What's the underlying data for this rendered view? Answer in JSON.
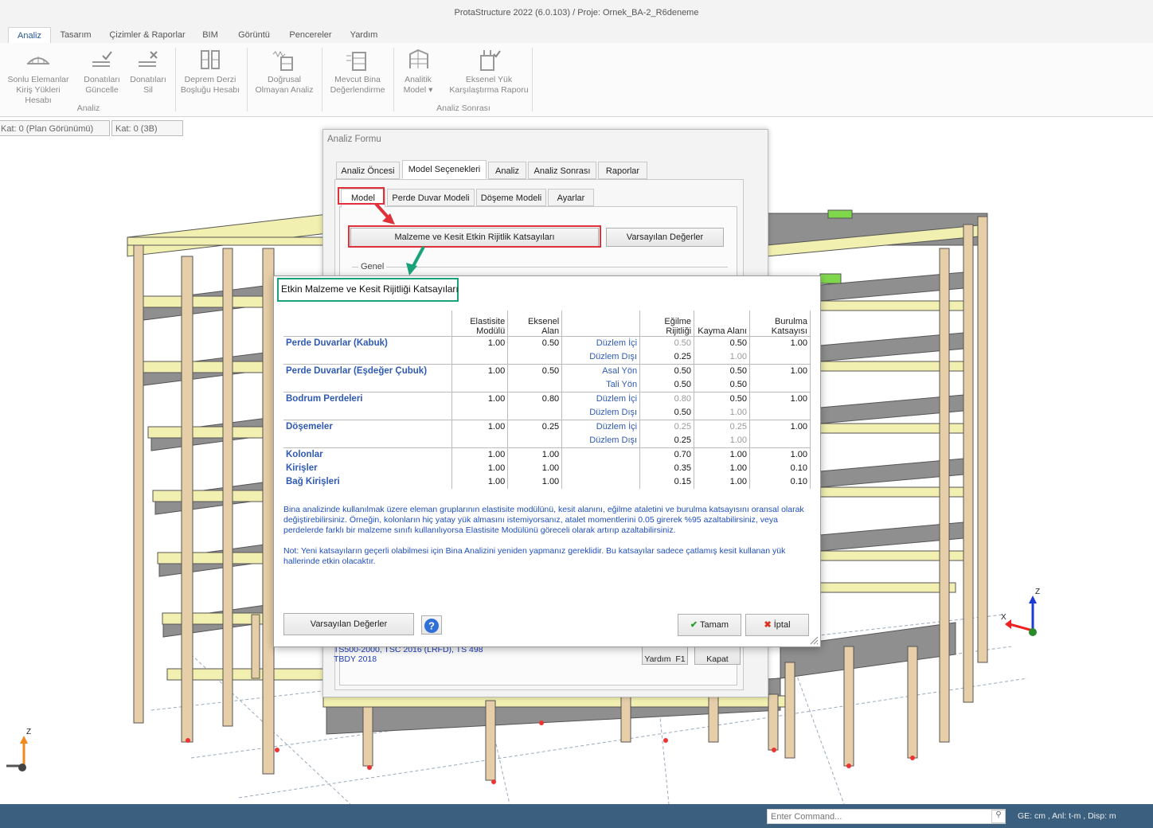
{
  "window": {
    "title": "ProtaStructure 2022 (6.0.103) / Proje: Ornek_BA-2_R6deneme"
  },
  "ribbon": {
    "tabs": [
      "Analiz",
      "Tasarım",
      "Çizimler & Raporlar",
      "BIM",
      "Görüntü",
      "Pencereler",
      "Yardım"
    ],
    "active_tab": "Analiz",
    "buttons": [
      {
        "line1": "Sonlu Elemanlar",
        "line2": "Kiriş Yükleri Hesabı",
        "icon": "bridge-icon"
      },
      {
        "line1": "Donatıları",
        "line2": "Güncelle",
        "icon": "rebar-check-icon"
      },
      {
        "line1": "Donatıları",
        "line2": "Sil",
        "icon": "rebar-delete-icon"
      },
      {
        "line1": "Deprem Derzi",
        "line2": "Boşluğu Hesabı",
        "icon": "building-gap-icon"
      },
      {
        "line1": "Doğrusal",
        "line2": "Olmayan Analiz",
        "icon": "seismic-icon"
      },
      {
        "line1": "Mevcut Bina",
        "line2": "Değerlendirme",
        "icon": "building-eval-icon"
      },
      {
        "line1": "Analitik",
        "line2": "Model ▾",
        "icon": "analytic-model-icon"
      },
      {
        "line1": "Eksenel Yük",
        "line2": "Karşılaştırma Raporu",
        "icon": "axial-report-icon"
      }
    ],
    "groups": [
      "Analiz",
      "Analiz Sonrası"
    ]
  },
  "view_tabs": [
    "Kat: 0 (Plan Görünümü)",
    "Kat: 0 (3B)"
  ],
  "analiz_formu": {
    "title": "Analiz Formu",
    "tabs": [
      "Analiz Öncesi",
      "Model Seçenekleri",
      "Analiz",
      "Analiz Sonrası",
      "Raporlar"
    ],
    "active_tab": "Model Seçenekleri",
    "sub_tabs": [
      "Model",
      "Perde Duvar Modeli",
      "Döşeme Modeli",
      "Ayarlar"
    ],
    "active_sub_tab": "Model",
    "btn_material": "Malzeme ve Kesit Etkin Rijitlik Katsayıları",
    "btn_default": "Varsayılan Değerler",
    "group_general": "Genel",
    "codes_line1": "TS500-2000,  TSC 2016 (LRFD),  TS 498",
    "codes_line2": "TBDY 2018",
    "help_label": "Yardım",
    "help_key": "F1",
    "close_label": "Kapat"
  },
  "dialog": {
    "title": "Etkin Malzeme ve Kesit Rijitliği Katsayıları",
    "columns": [
      "Elastisite Modülü",
      "Eksenel Alan",
      "",
      "Eğilme Rijitliği",
      "Kayma Alanı",
      "Burulma Katsayısı"
    ],
    "groups": [
      {
        "name": "Perde Duvarlar (Kabuk)",
        "e": "1.00",
        "a": "0.50",
        "rows": [
          {
            "dir": "Düzlem İçi",
            "ei": "0.50",
            "ei_grey": true,
            "ka": "0.50",
            "ka_grey": false,
            "bk": "1.00"
          },
          {
            "dir": "Düzlem Dışı",
            "ei": "0.25",
            "ei_grey": false,
            "ka": "1.00",
            "ka_grey": true,
            "bk": ""
          }
        ]
      },
      {
        "name": "Perde Duvarlar (Eşdeğer Çubuk)",
        "e": "1.00",
        "a": "0.50",
        "rows": [
          {
            "dir": "Asal Yön",
            "ei": "0.50",
            "ei_grey": false,
            "ka": "0.50",
            "ka_grey": false,
            "bk": "1.00"
          },
          {
            "dir": "Tali Yön",
            "ei": "0.50",
            "ei_grey": false,
            "ka": "0.50",
            "ka_grey": false,
            "bk": ""
          }
        ]
      },
      {
        "name": "Bodrum Perdeleri",
        "e": "1.00",
        "a": "0.80",
        "rows": [
          {
            "dir": "Düzlem İçi",
            "ei": "0.80",
            "ei_grey": true,
            "ka": "0.50",
            "ka_grey": false,
            "bk": "1.00"
          },
          {
            "dir": "Düzlem Dışı",
            "ei": "0.50",
            "ei_grey": false,
            "ka": "1.00",
            "ka_grey": true,
            "bk": ""
          }
        ]
      },
      {
        "name": "Döşemeler",
        "e": "1.00",
        "a": "0.25",
        "rows": [
          {
            "dir": "Düzlem İçi",
            "ei": "0.25",
            "ei_grey": true,
            "ka": "0.25",
            "ka_grey": true,
            "bk": "1.00"
          },
          {
            "dir": "Düzlem Dışı",
            "ei": "0.25",
            "ei_grey": false,
            "ka": "1.00",
            "ka_grey": true,
            "bk": ""
          }
        ]
      }
    ],
    "frame_rows": [
      {
        "name": "Kolonlar",
        "e": "1.00",
        "a": "1.00",
        "ei": "0.70",
        "ka": "1.00",
        "bk": "1.00"
      },
      {
        "name": "Kirişler",
        "e": "1.00",
        "a": "1.00",
        "ei": "0.35",
        "ka": "1.00",
        "bk": "0.10"
      },
      {
        "name": "Bağ Kirişleri",
        "e": "1.00",
        "a": "1.00",
        "ei": "0.15",
        "ka": "1.00",
        "bk": "0.10"
      }
    ],
    "note1": "Bina analizinde kullanılmak üzere eleman gruplarının elastisite modülünü, kesit alanını, eğilme ataletini ve burulma katsayısını oransal olarak değiştirebilirsiniz. Örneğin, kolonların hiç yatay yük almasını istemiyorsanız, atalet momentlerini 0.05 girerek %95 azaltabilirsiniz, veya perdelerde farklı bir malzeme sınıfı kullanılıyorsa Elastisite Modülünü göreceli olarak artırıp azaltabilirsiniz.",
    "note2": "Not: Yeni katsayıların geçerli olabilmesi için Bina Analizini yeniden yapmanız gereklidir. Bu katsayılar sadece çatlamış kesit kullanan yük hallerinde etkin olacaktır.",
    "btn_default": "Varsayılan Değerler",
    "btn_ok": "Tamam",
    "btn_cancel": "İptal"
  },
  "statusbar": {
    "command_placeholder": "Enter Command...",
    "info": "GE: cm , Anl: t-m , Disp: m"
  },
  "axes": {
    "x": "X",
    "z": "Z"
  },
  "colors": {
    "highlight_red": "#e0303a",
    "highlight_green": "#1aa37a",
    "beam": "#f2f0b0",
    "slab": "#8f8f8f",
    "statusbar": "#3a5f7f",
    "link_blue": "#2f5ab4"
  }
}
